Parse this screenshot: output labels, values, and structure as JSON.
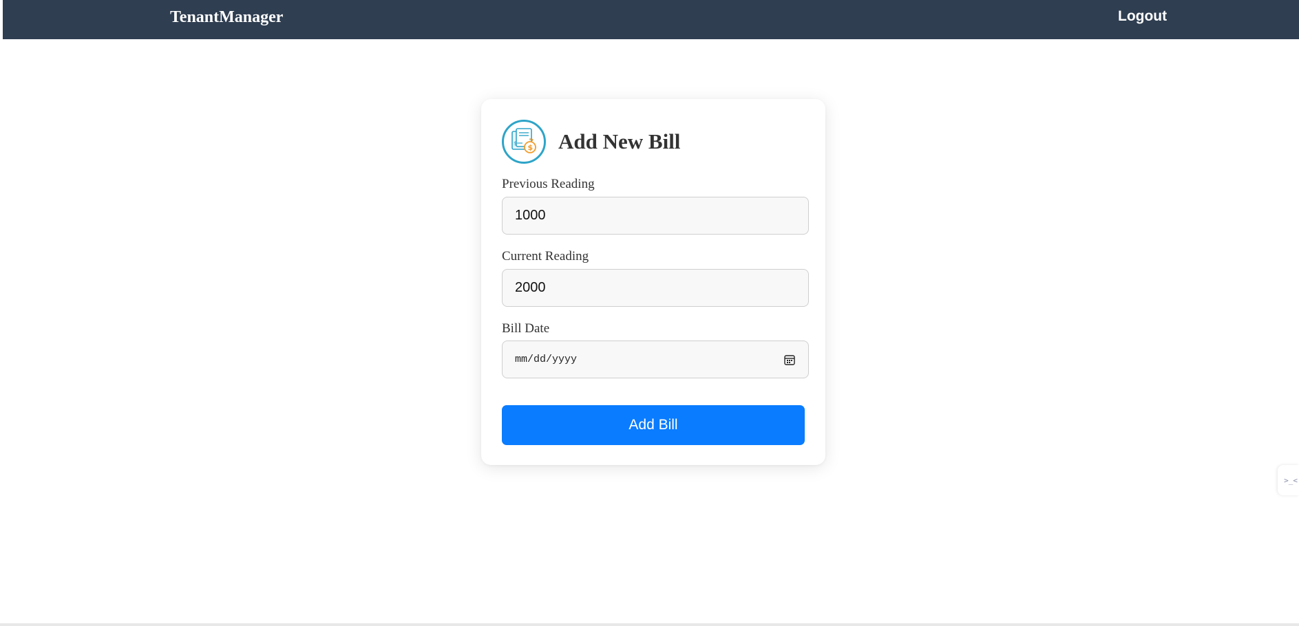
{
  "navbar": {
    "brand": "TenantManager",
    "logout_label": "Logout"
  },
  "form": {
    "title": "Add New Bill",
    "icon": "bill-invoice-icon",
    "previous_reading": {
      "label": "Previous Reading",
      "value": "1000"
    },
    "current_reading": {
      "label": "Current Reading",
      "value": "2000"
    },
    "bill_date": {
      "label": "Bill Date",
      "placeholder": "mm/dd/yyyy"
    },
    "submit_label": "Add Bill"
  },
  "side_widget": {
    "icon": "terminal-icon",
    "text": ">_<"
  },
  "colors": {
    "navbar": "#2f3e51",
    "primary_button": "#0a7cff",
    "icon_ring": "#2ea4c8",
    "icon_accent": "#f39c2a"
  }
}
